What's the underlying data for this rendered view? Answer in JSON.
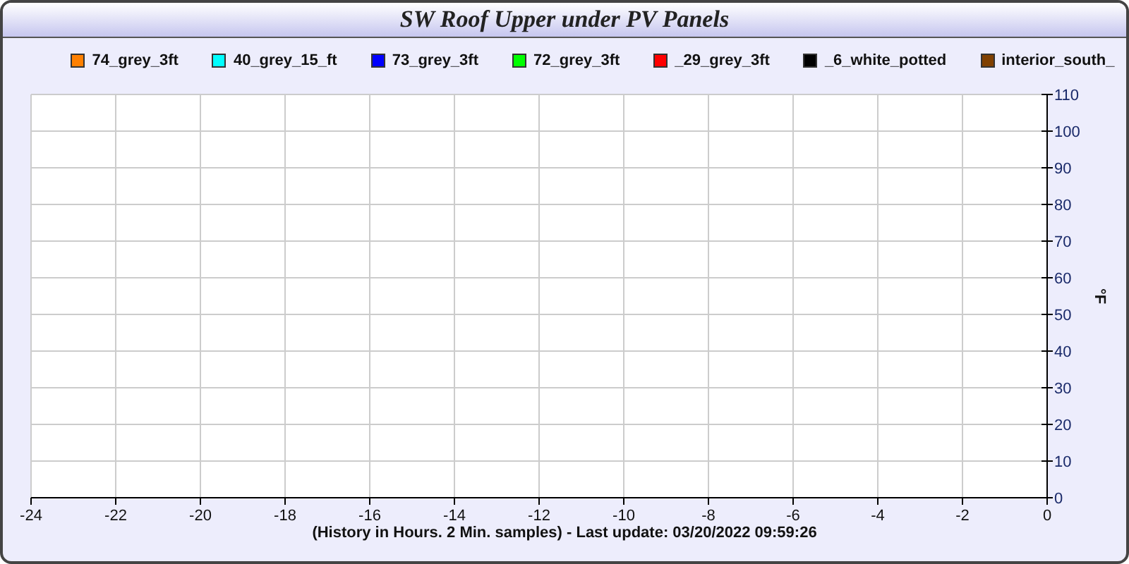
{
  "panel": {
    "title": "SW Roof Upper under PV Panels",
    "footer": "(History in Hours. 2 Min. samples) - Last update: 03/20/2022 09:59:26",
    "chart_data": {
      "type": "line",
      "ylabel": "°F",
      "grid": true,
      "ylim": [
        0,
        110
      ],
      "categories": [
        "-24",
        "-22",
        "-20",
        "-18",
        "-16",
        "-14",
        "-12",
        "-10",
        "-8",
        "-6",
        "-4",
        "-2",
        "0"
      ],
      "yticks": [
        0,
        10,
        20,
        30,
        40,
        50,
        60,
        70,
        80,
        90,
        100,
        110
      ],
      "series": [
        {
          "name": "74_grey_3ft",
          "color": "#ff8000",
          "values": [
            null,
            null,
            null,
            null,
            null,
            null,
            null,
            null,
            null,
            null,
            null,
            null,
            null
          ]
        },
        {
          "name": "40_grey_15_ft",
          "color": "#00ffff",
          "values": [
            null,
            null,
            null,
            null,
            null,
            null,
            null,
            null,
            null,
            null,
            null,
            null,
            null
          ]
        },
        {
          "name": "73_grey_3ft",
          "color": "#0000ff",
          "values": [
            null,
            null,
            null,
            null,
            null,
            null,
            null,
            null,
            null,
            null,
            null,
            null,
            null
          ]
        },
        {
          "name": "72_grey_3ft",
          "color": "#00ff00",
          "values": [
            null,
            null,
            null,
            null,
            null,
            null,
            null,
            null,
            null,
            null,
            null,
            null,
            null
          ]
        },
        {
          "name": "_29_grey_3ft",
          "color": "#ff0000",
          "values": [
            null,
            null,
            null,
            null,
            null,
            null,
            null,
            null,
            null,
            null,
            null,
            null,
            null
          ]
        },
        {
          "name": "_6_white_potted",
          "color": "#000000",
          "values": [
            null,
            null,
            null,
            null,
            null,
            null,
            null,
            null,
            null,
            null,
            null,
            null,
            null
          ]
        },
        {
          "name": "interior_south_",
          "color": "#804000",
          "values": [
            null,
            null,
            null,
            null,
            null,
            null,
            null,
            null,
            null,
            null,
            null,
            null,
            null
          ]
        }
      ]
    }
  }
}
